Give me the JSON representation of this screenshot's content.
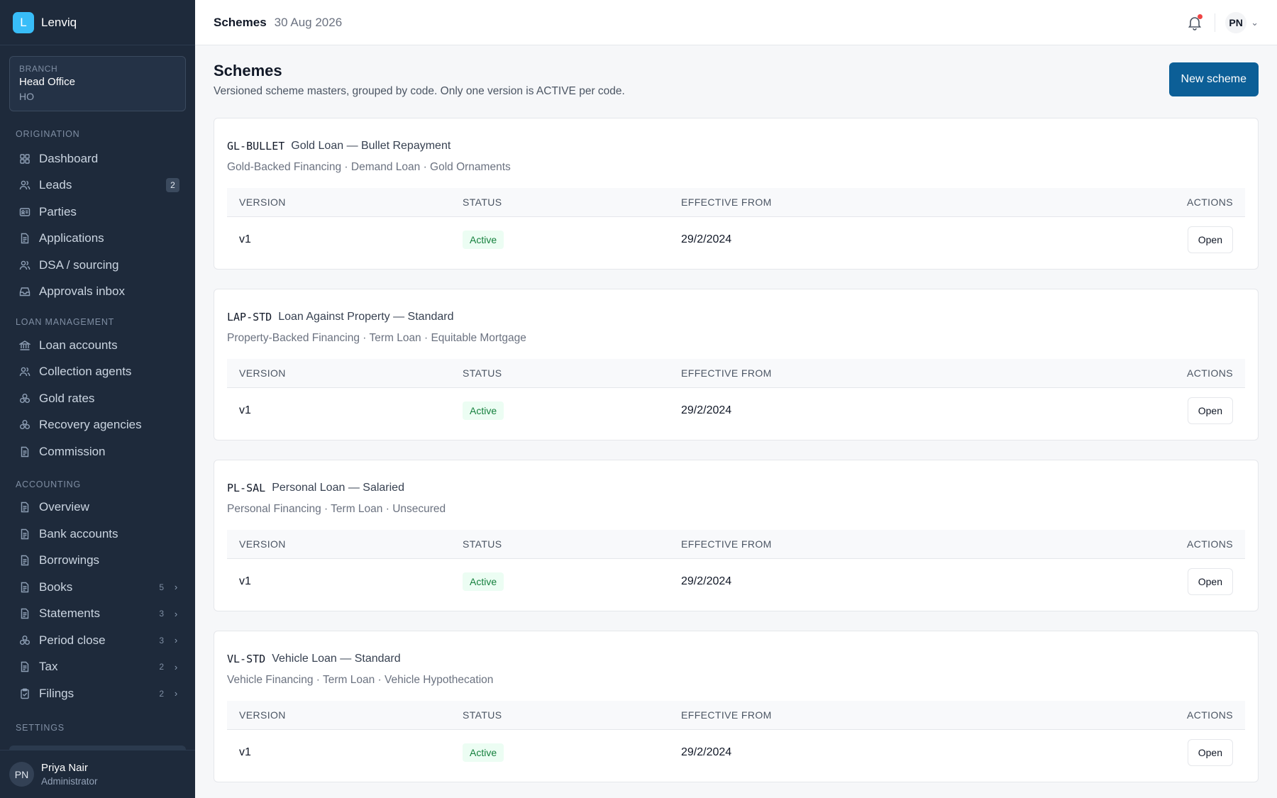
{
  "app": {
    "logo_letter": "L",
    "name": "Lenviq"
  },
  "branch": {
    "label": "BRANCH",
    "name": "Head Office",
    "code": "HO"
  },
  "sidebar": {
    "sections": [
      {
        "label": "ORIGINATION",
        "items": [
          {
            "label": "Dashboard",
            "icon": "dashboard-icon"
          },
          {
            "label": "Leads",
            "icon": "users-icon",
            "badge": "2"
          },
          {
            "label": "Parties",
            "icon": "id-card-icon"
          },
          {
            "label": "Applications",
            "icon": "document-icon"
          },
          {
            "label": "DSA / sourcing",
            "icon": "users-icon"
          },
          {
            "label": "Approvals inbox",
            "icon": "inbox-icon"
          }
        ]
      },
      {
        "label": "LOAN MANAGEMENT",
        "items": [
          {
            "label": "Loan accounts",
            "icon": "bank-icon"
          },
          {
            "label": "Collection agents",
            "icon": "users-icon"
          },
          {
            "label": "Gold rates",
            "icon": "coins-icon"
          },
          {
            "label": "Recovery agencies",
            "icon": "coins-icon"
          },
          {
            "label": "Commission",
            "icon": "document-icon"
          }
        ]
      },
      {
        "label": "ACCOUNTING",
        "items": [
          {
            "label": "Overview",
            "icon": "document-icon"
          },
          {
            "label": "Bank accounts",
            "icon": "document-icon"
          },
          {
            "label": "Borrowings",
            "icon": "document-icon"
          },
          {
            "label": "Books",
            "icon": "document-icon",
            "count": "5"
          },
          {
            "label": "Statements",
            "icon": "document-icon",
            "count": "3"
          },
          {
            "label": "Period close",
            "icon": "coins-icon",
            "count": "3"
          },
          {
            "label": "Tax",
            "icon": "document-icon",
            "count": "2"
          },
          {
            "label": "Filings",
            "icon": "clipboard-icon",
            "count": "2"
          }
        ]
      },
      {
        "label": "SETTINGS",
        "items": []
      }
    ]
  },
  "user": {
    "initials": "PN",
    "name": "Priya Nair",
    "role": "Administrator"
  },
  "topbar": {
    "title": "Schemes",
    "date": "30 Aug 2026",
    "user_initials": "PN"
  },
  "page": {
    "title": "Schemes",
    "subtitle": "Versioned scheme masters, grouped by code. Only one version is ACTIVE per code.",
    "new_button": "New scheme"
  },
  "table_headers": {
    "version": "VERSION",
    "status": "STATUS",
    "effective_from": "EFFECTIVE FROM",
    "actions": "ACTIONS"
  },
  "schemes": [
    {
      "code": "GL-BULLET",
      "name": "Gold Loan — Bullet Repayment",
      "tags": "Gold-Backed Financing · Demand Loan · Gold Ornaments",
      "rows": [
        {
          "version": "v1",
          "status": "Active",
          "effective_from": "29/2/2024",
          "action": "Open"
        }
      ]
    },
    {
      "code": "LAP-STD",
      "name": "Loan Against Property — Standard",
      "tags": "Property-Backed Financing · Term Loan · Equitable Mortgage",
      "rows": [
        {
          "version": "v1",
          "status": "Active",
          "effective_from": "29/2/2024",
          "action": "Open"
        }
      ]
    },
    {
      "code": "PL-SAL",
      "name": "Personal Loan — Salaried",
      "tags": "Personal Financing · Term Loan · Unsecured",
      "rows": [
        {
          "version": "v1",
          "status": "Active",
          "effective_from": "29/2/2024",
          "action": "Open"
        }
      ]
    },
    {
      "code": "VL-STD",
      "name": "Vehicle Loan — Standard",
      "tags": "Vehicle Financing · Term Loan · Vehicle Hypothecation",
      "rows": [
        {
          "version": "v1",
          "status": "Active",
          "effective_from": "29/2/2024",
          "action": "Open"
        }
      ]
    }
  ]
}
